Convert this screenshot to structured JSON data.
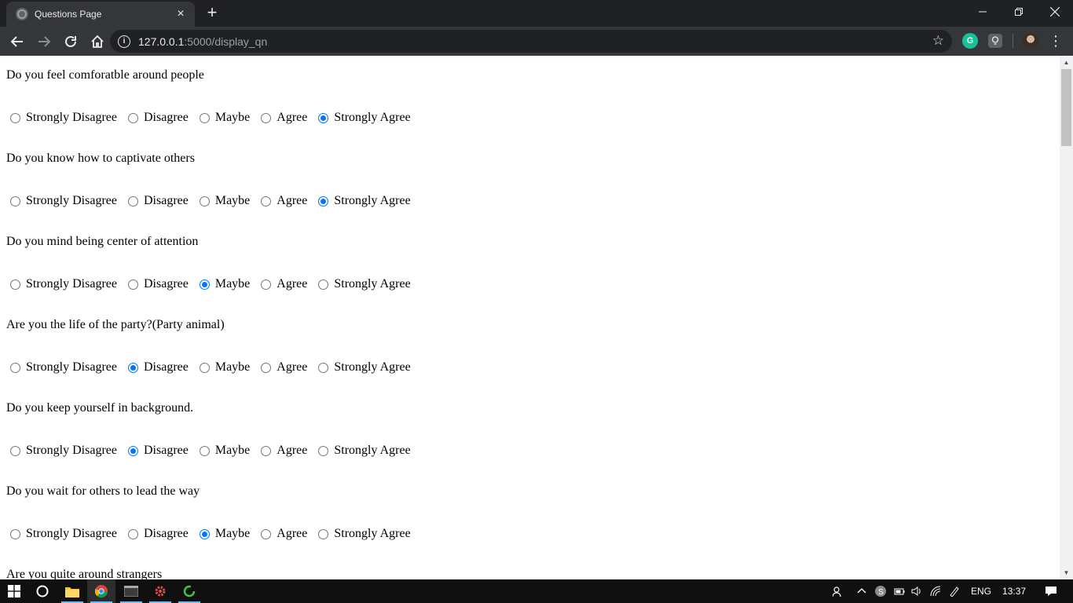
{
  "browser": {
    "tab": {
      "title": "Questions Page",
      "close_icon": "×"
    },
    "new_tab_icon": "+",
    "window_controls": {
      "minimize": "—",
      "restore": "❐",
      "close": "✕"
    },
    "url": {
      "host": "127.0.0.1",
      "rest": ":5000/display_qn"
    },
    "info_icon": "i",
    "star_icon": "☆",
    "extension_label": "G",
    "menu_icon": "⋮"
  },
  "options": [
    "Strongly Disagree",
    "Disagree",
    "Maybe",
    "Agree",
    "Strongly Agree"
  ],
  "questions": [
    {
      "text": "Do you feel comforatble around people",
      "selected": 4
    },
    {
      "text": "Do you know how to captivate others",
      "selected": 4
    },
    {
      "text": "Do you mind being center of attention",
      "selected": 2
    },
    {
      "text": "Are you the life of the party?(Party animal)",
      "selected": 1
    },
    {
      "text": "Do you keep yourself in background.",
      "selected": 1
    },
    {
      "text": "Do you wait for others to lead the way",
      "selected": 2
    },
    {
      "text": "Are you quite around strangers",
      "selected": null
    }
  ],
  "taskbar": {
    "tray": {
      "language": "ENG",
      "time": "13:37"
    }
  },
  "colors": {
    "accent": "#0075ff",
    "chrome_dark": "#202124",
    "chrome_toolbar": "#35363a",
    "taskbar": "#101010"
  }
}
